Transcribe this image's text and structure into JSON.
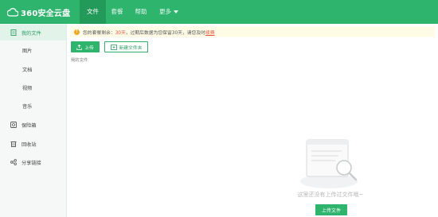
{
  "app": {
    "logo_text": "360安全云盘"
  },
  "nav": {
    "items": [
      {
        "label": "文件"
      },
      {
        "label": "套餐"
      },
      {
        "label": "帮助"
      },
      {
        "label": "更多"
      }
    ]
  },
  "sidebar": {
    "items": [
      {
        "label": "我的文件",
        "icon": "file-icon"
      },
      {
        "label": "图片"
      },
      {
        "label": "文档"
      },
      {
        "label": "视频"
      },
      {
        "label": "音乐"
      },
      {
        "label": "保险箱",
        "icon": "safe-icon"
      },
      {
        "label": "回收站",
        "icon": "recycle-bin-icon"
      },
      {
        "label": "分享链接",
        "icon": "share-icon"
      }
    ]
  },
  "notice": {
    "prefix": "您的套餐剩余：",
    "days": "30天",
    "middle": "，过期后数据为您保留30天，请您及时",
    "link": "续费"
  },
  "toolbar": {
    "upload_label": "上传",
    "new_folder_label": "新建文件夹"
  },
  "breadcrumb": {
    "text": "我的文件"
  },
  "empty_state": {
    "message": "这里还没有上传过文件哦~",
    "button_label": "上传文件"
  },
  "colors": {
    "brand_green": "#2fb46e",
    "warning_red": "#e8543f"
  }
}
